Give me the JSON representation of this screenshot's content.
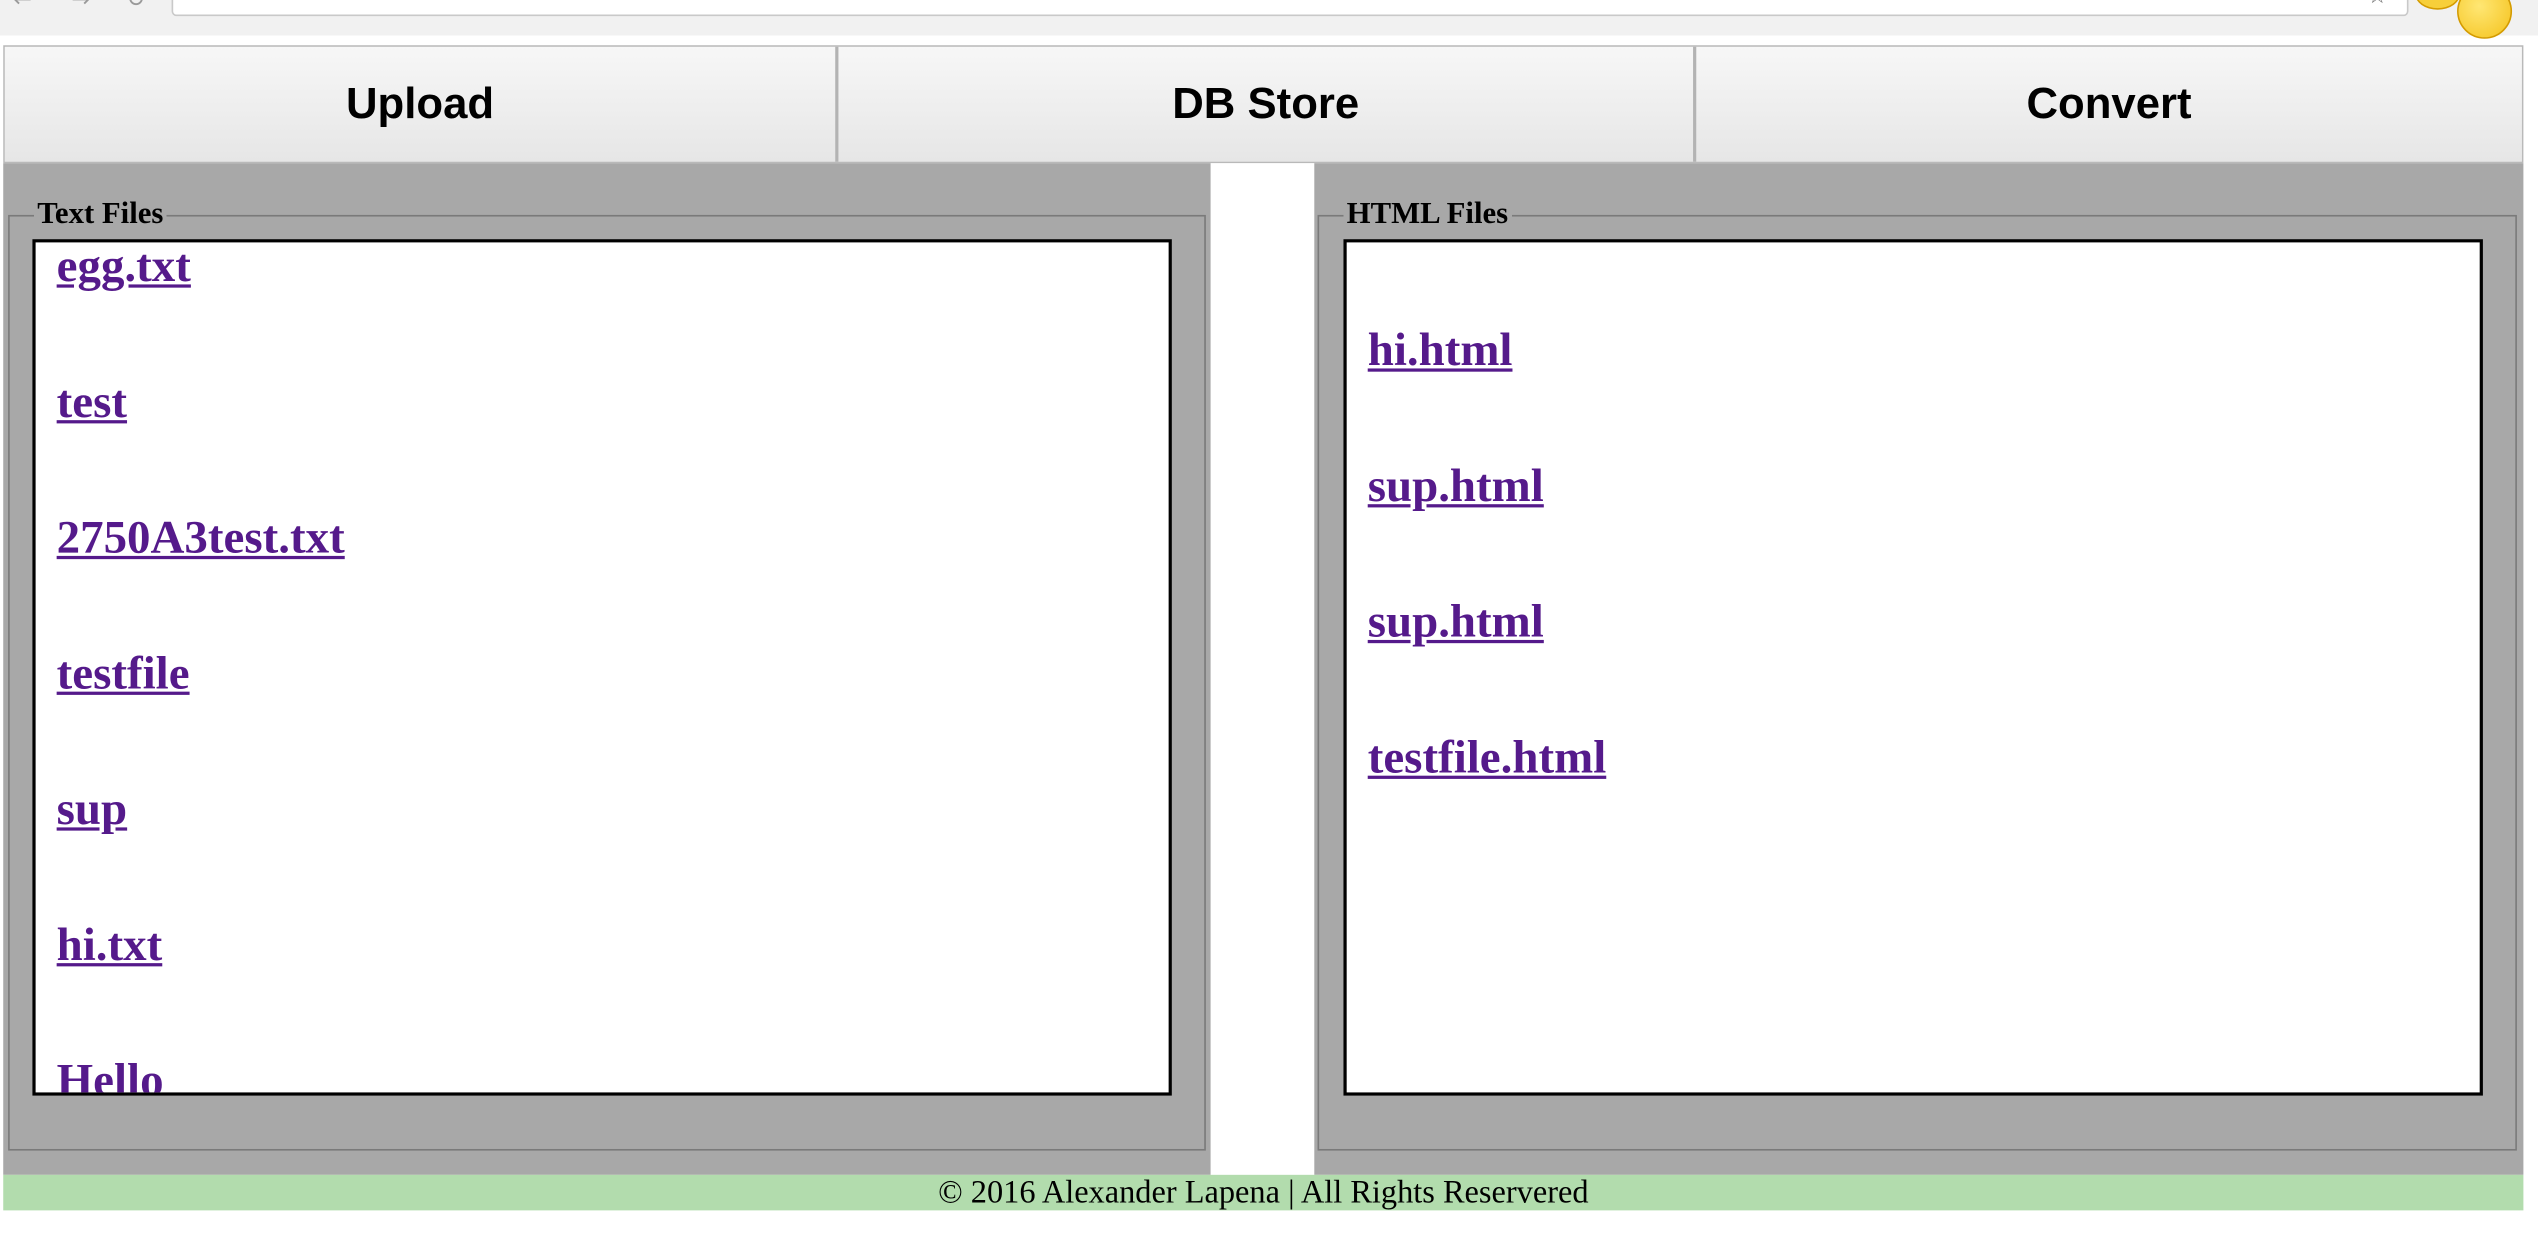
{
  "nav": {
    "upload": "Upload",
    "db_store": "DB Store",
    "convert": "Convert"
  },
  "text_panel": {
    "legend": "Text Files",
    "files": [
      "egg.txt",
      "test",
      "2750A3test.txt",
      "testfile",
      "sup",
      "hi.txt",
      "Hello"
    ]
  },
  "html_panel": {
    "legend": "HTML Files",
    "files": [
      "hi.html",
      "sup.html",
      "sup.html",
      "testfile.html"
    ]
  },
  "footer": {
    "text": "© 2016 Alexander Lapena | All Rights Reservered"
  },
  "colors": {
    "link": "#551a8b",
    "panel_bg": "#a8a8a8",
    "footer_bg": "#b2dcad",
    "tab_bg": "#eeeeee"
  },
  "icons": [
    "back-arrow-icon",
    "forward-arrow-icon",
    "reload-icon",
    "bookmark-star-icon",
    "extension-badge-icon"
  ]
}
